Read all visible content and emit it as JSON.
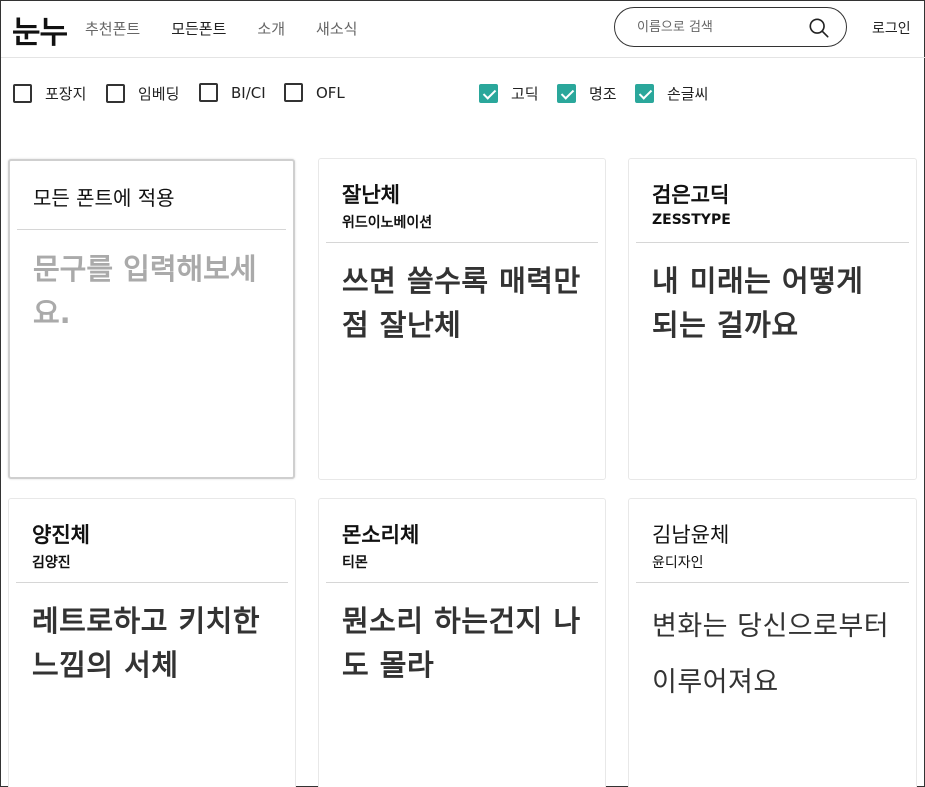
{
  "header": {
    "logo": "눈누",
    "nav": [
      "추천폰트",
      "모든폰트",
      "소개",
      "새소식"
    ],
    "search_placeholder": "이름으로 검색",
    "login": "로그인"
  },
  "filters": {
    "license": [
      {
        "label": "포장지",
        "checked": false
      },
      {
        "label": "임베딩",
        "checked": false
      },
      {
        "label": "BI/CI",
        "checked": false
      },
      {
        "label": "OFL",
        "checked": false
      }
    ],
    "style": [
      {
        "label": "고딕",
        "checked": true
      },
      {
        "label": "명조",
        "checked": true
      },
      {
        "label": "손글씨",
        "checked": true
      }
    ]
  },
  "apply_card": {
    "title": "모든 폰트에 적용",
    "placeholder": "문구를 입력해보세요."
  },
  "fonts": [
    {
      "name": "잘난체",
      "maker": "위드이노베이션",
      "sample": "쓰면 쓸수록 매력만점 잘난체"
    },
    {
      "name": "검은고딕",
      "maker": "ZESSTYPE",
      "sample": "내 미래는 어떻게 되는 걸까요"
    },
    {
      "name": "양진체",
      "maker": "김양진",
      "sample": "레트로하고 키치한 느낌의 서체"
    },
    {
      "name": "몬소리체",
      "maker": "티몬",
      "sample": "뭔소리 하는건지 나도 몰라"
    },
    {
      "name": "김남윤체",
      "maker": "윤디자인",
      "sample": "변화는 당신으로부터 이루어져요"
    }
  ]
}
